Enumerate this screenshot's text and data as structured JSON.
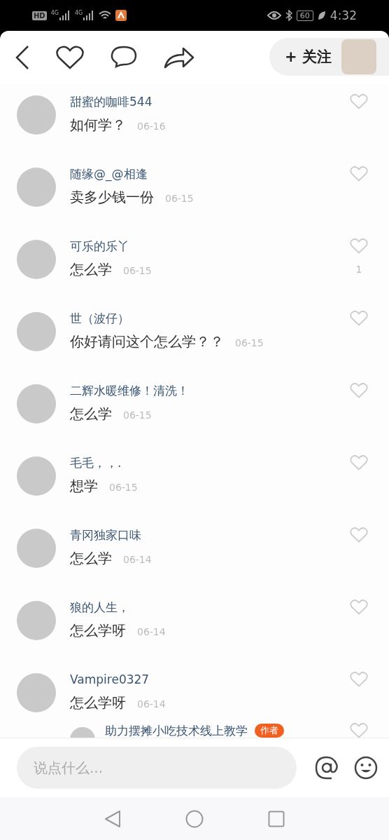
{
  "status_bar": {
    "hd": "HD",
    "networks": [
      "4G",
      "4G"
    ],
    "battery": "60",
    "time": "4:32"
  },
  "header": {
    "follow_button": "+ 关注"
  },
  "comments": [
    {
      "name": "甜蜜的咖啡544",
      "text": "如何学？",
      "date": "06-16"
    },
    {
      "name": "随缘@_@相逢",
      "text": "卖多少钱一份",
      "date": "06-15"
    },
    {
      "name": "可乐的乐丫",
      "text": "怎么学",
      "date": "06-15",
      "likes": "1"
    },
    {
      "name": "世（波仔）",
      "text": "你好请问这个怎么学？？",
      "date": "06-15"
    },
    {
      "name": "二辉水暖维修！清洗！",
      "text": "怎么学",
      "date": "06-15"
    },
    {
      "name": "毛毛，，.",
      "text": "想学",
      "date": "06-15"
    },
    {
      "name": "青冈独家口味",
      "text": "怎么学",
      "date": "06-14"
    },
    {
      "name": "狼的人生，",
      "text": "怎么学呀",
      "date": "06-14"
    },
    {
      "name": "Vampire0327",
      "text": "怎么学呀",
      "date": "06-14"
    },
    {
      "name": "助力摆摊小吃技术线上教学",
      "badge": "作者",
      "kind": "reply"
    }
  ],
  "input": {
    "placeholder": "说点什么..."
  }
}
